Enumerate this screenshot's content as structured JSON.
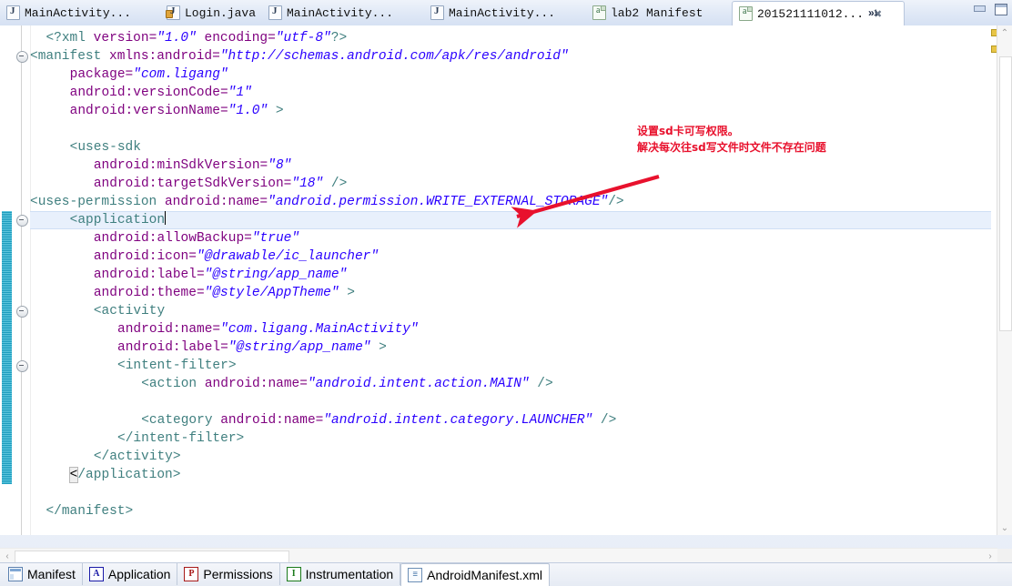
{
  "window": {
    "minimize_label": "Minimize",
    "maximize_label": "Maximize",
    "overflow_label": "»",
    "overflow_count": "1"
  },
  "tabs": [
    {
      "label": "MainActivity...",
      "icon": "java-file-icon",
      "active": false,
      "closable": false
    },
    {
      "label": "Login.java",
      "icon": "java-file-locked-icon",
      "active": false,
      "closable": false
    },
    {
      "label": "MainActivity...",
      "icon": "java-file-icon",
      "active": false,
      "closable": false
    },
    {
      "label": "MainActivity...",
      "icon": "java-file-icon",
      "active": false,
      "closable": false
    },
    {
      "label": "lab2 Manifest",
      "icon": "xml-file-icon",
      "active": false,
      "closable": false
    },
    {
      "label": "201521111012...",
      "icon": "xml-file-icon",
      "active": true,
      "closable": true,
      "close_glyph": "✖"
    }
  ],
  "editor": {
    "current_line_index": 10,
    "lines": [
      {
        "indent": 2,
        "segments": [
          {
            "t": "<?xml ",
            "c": "br"
          },
          {
            "t": "version=",
            "c": "at"
          },
          {
            "t": "\"1.0\"",
            "c": "vl"
          },
          {
            "t": " encoding=",
            "c": "at"
          },
          {
            "t": "\"utf-8\"",
            "c": "vl"
          },
          {
            "t": "?>",
            "c": "br"
          }
        ],
        "fold": false
      },
      {
        "indent": 0,
        "segments": [
          {
            "t": "<manifest ",
            "c": "br"
          },
          {
            "t": "xmlns:android=",
            "c": "at"
          },
          {
            "t": "\"http://schemas.android.com/apk/res/android\"",
            "c": "vl"
          }
        ],
        "fold": true
      },
      {
        "indent": 5,
        "segments": [
          {
            "t": "package=",
            "c": "at"
          },
          {
            "t": "\"com.ligang\"",
            "c": "vl"
          }
        ],
        "fold": false
      },
      {
        "indent": 5,
        "segments": [
          {
            "t": "android:versionCode=",
            "c": "at"
          },
          {
            "t": "\"1\"",
            "c": "vl"
          }
        ],
        "fold": false
      },
      {
        "indent": 5,
        "segments": [
          {
            "t": "android:versionName=",
            "c": "at"
          },
          {
            "t": "\"1.0\"",
            "c": "vl"
          },
          {
            "t": " >",
            "c": "br"
          }
        ],
        "fold": false
      },
      {
        "indent": 0,
        "segments": [],
        "fold": false
      },
      {
        "indent": 5,
        "segments": [
          {
            "t": "<uses-sdk",
            "c": "br"
          }
        ],
        "fold": false
      },
      {
        "indent": 8,
        "segments": [
          {
            "t": "android:minSdkVersion=",
            "c": "at"
          },
          {
            "t": "\"8\"",
            "c": "vl"
          }
        ],
        "fold": false
      },
      {
        "indent": 8,
        "segments": [
          {
            "t": "android:targetSdkVersion=",
            "c": "at"
          },
          {
            "t": "\"18\"",
            "c": "vl"
          },
          {
            "t": " />",
            "c": "br"
          }
        ],
        "fold": false
      },
      {
        "indent": 0,
        "segments": [
          {
            "t": "<uses-permission ",
            "c": "br"
          },
          {
            "t": "android:name=",
            "c": "at"
          },
          {
            "t": "\"android.permission.WRITE_EXTERNAL_STORAGE\"",
            "c": "vl"
          },
          {
            "t": "/>",
            "c": "br"
          }
        ],
        "fold": false
      },
      {
        "indent": 5,
        "segments": [
          {
            "t": "<application",
            "c": "br"
          }
        ],
        "fold": true,
        "caret": true
      },
      {
        "indent": 8,
        "segments": [
          {
            "t": "android:allowBackup=",
            "c": "at"
          },
          {
            "t": "\"true\"",
            "c": "vl"
          }
        ],
        "fold": false
      },
      {
        "indent": 8,
        "segments": [
          {
            "t": "android:icon=",
            "c": "at"
          },
          {
            "t": "\"@drawable/ic_launcher\"",
            "c": "vl"
          }
        ],
        "fold": false
      },
      {
        "indent": 8,
        "segments": [
          {
            "t": "android:label=",
            "c": "at"
          },
          {
            "t": "\"@string/app_name\"",
            "c": "vl"
          }
        ],
        "fold": false
      },
      {
        "indent": 8,
        "segments": [
          {
            "t": "android:theme=",
            "c": "at"
          },
          {
            "t": "\"@style/AppTheme\"",
            "c": "vl"
          },
          {
            "t": " >",
            "c": "br"
          }
        ],
        "fold": false
      },
      {
        "indent": 8,
        "segments": [
          {
            "t": "<activity",
            "c": "br"
          }
        ],
        "fold": true
      },
      {
        "indent": 11,
        "segments": [
          {
            "t": "android:name=",
            "c": "at"
          },
          {
            "t": "\"com.ligang.MainActivity\"",
            "c": "vl"
          }
        ],
        "fold": false
      },
      {
        "indent": 11,
        "segments": [
          {
            "t": "android:label=",
            "c": "at"
          },
          {
            "t": "\"@string/app_name\"",
            "c": "vl"
          },
          {
            "t": " >",
            "c": "br"
          }
        ],
        "fold": false
      },
      {
        "indent": 11,
        "segments": [
          {
            "t": "<intent-filter>",
            "c": "br"
          }
        ],
        "fold": true
      },
      {
        "indent": 14,
        "segments": [
          {
            "t": "<action ",
            "c": "br"
          },
          {
            "t": "android:name=",
            "c": "at"
          },
          {
            "t": "\"android.intent.action.MAIN\"",
            "c": "vl"
          },
          {
            "t": " />",
            "c": "br"
          }
        ],
        "fold": false
      },
      {
        "indent": 0,
        "segments": [],
        "fold": false
      },
      {
        "indent": 14,
        "segments": [
          {
            "t": "<category ",
            "c": "br"
          },
          {
            "t": "android:name=",
            "c": "at"
          },
          {
            "t": "\"android.intent.category.LAUNCHER\"",
            "c": "vl"
          },
          {
            "t": " />",
            "c": "br"
          }
        ],
        "fold": false
      },
      {
        "indent": 11,
        "segments": [
          {
            "t": "</intent-filter>",
            "c": "br"
          }
        ],
        "fold": false
      },
      {
        "indent": 8,
        "segments": [
          {
            "t": "</activity>",
            "c": "br"
          }
        ],
        "fold": false
      },
      {
        "indent": 5,
        "segments": [
          {
            "t": "<",
            "c": "brbox"
          },
          {
            "t": "/application>",
            "c": "br"
          }
        ],
        "fold": false
      },
      {
        "indent": 0,
        "segments": [],
        "fold": false
      },
      {
        "indent": 2,
        "segments": [
          {
            "t": "</manifest>",
            "c": "br"
          }
        ],
        "fold": false
      }
    ]
  },
  "annotation": {
    "line1": "设置sd卡可写权限。",
    "line2": "解决每次往sd写文件时文件不存在问题",
    "color": "#e8112d"
  },
  "scrollbars": {
    "up_glyph": "⌃",
    "down_glyph": "⌄",
    "left_glyph": "‹",
    "right_glyph": "›"
  },
  "bottom_tabs": [
    {
      "label": "Manifest",
      "icon": "manifest-icon",
      "selected": false
    },
    {
      "label": "Application",
      "icon": "application-a-icon",
      "selected": false,
      "glyph": "A"
    },
    {
      "label": "Permissions",
      "icon": "permissions-p-icon",
      "selected": false,
      "glyph": "P"
    },
    {
      "label": "Instrumentation",
      "icon": "instrumentation-i-icon",
      "selected": false,
      "glyph": "I"
    },
    {
      "label": "AndroidManifest.xml",
      "icon": "xml-source-icon",
      "selected": true
    }
  ]
}
